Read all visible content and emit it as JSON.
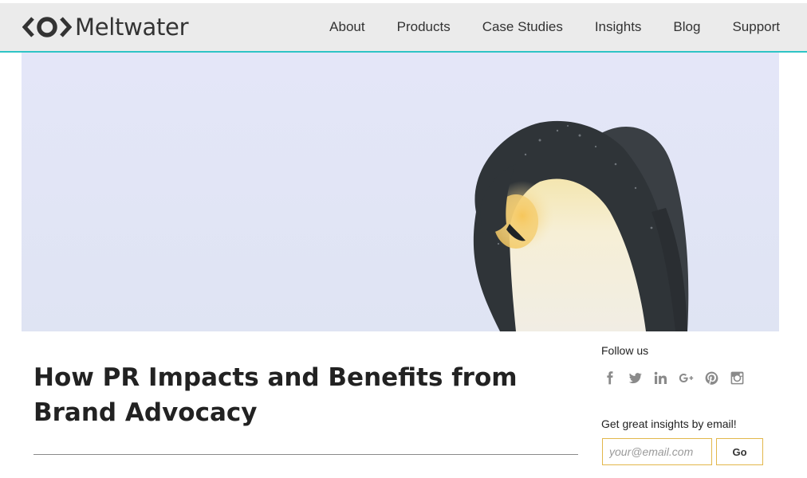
{
  "header": {
    "logo_text": "Meltwater",
    "logo_icon": "meltwater-logo-icon",
    "accent_color": "#2ec4c6",
    "nav": [
      {
        "label": "About"
      },
      {
        "label": "Products"
      },
      {
        "label": "Case Studies"
      },
      {
        "label": "Insights"
      },
      {
        "label": "Blog"
      },
      {
        "label": "Support"
      }
    ]
  },
  "hero": {
    "image_subject": "emperor penguin"
  },
  "article": {
    "title": "How PR Impacts and Benefits from Brand Advocacy"
  },
  "sidebar": {
    "follow_label": "Follow us",
    "social": [
      {
        "icon": "facebook-icon"
      },
      {
        "icon": "twitter-icon"
      },
      {
        "icon": "linkedin-icon"
      },
      {
        "icon": "google-plus-icon"
      },
      {
        "icon": "pinterest-icon"
      },
      {
        "icon": "instagram-icon"
      }
    ],
    "email_label": "Get great insights by email!",
    "email_placeholder": "your@email.com",
    "email_value": "",
    "go_label": "Go",
    "button_border_color": "#e2b74b"
  }
}
